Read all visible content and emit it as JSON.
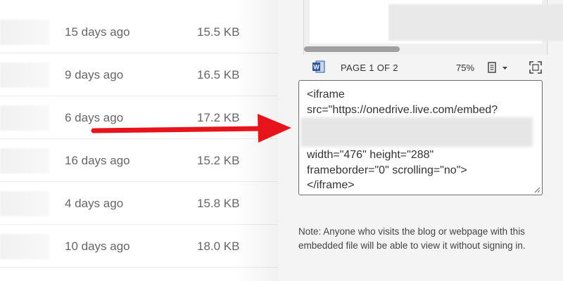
{
  "file_list": {
    "rows": [
      {
        "modified": "15 days ago",
        "size": "15.5 KB"
      },
      {
        "modified": "9 days ago",
        "size": "16.5 KB"
      },
      {
        "modified": "6 days ago",
        "size": "17.2 KB"
      },
      {
        "modified": "16 days ago",
        "size": "15.2 KB"
      },
      {
        "modified": "4 days ago",
        "size": "15.8 KB"
      },
      {
        "modified": "10 days ago",
        "size": "18.0 KB"
      }
    ]
  },
  "preview_toolbar": {
    "app_icon": "word-icon",
    "page_indicator": "PAGE 1 OF 2",
    "zoom": "75%",
    "view_icon": "document-view-icon",
    "fullscreen_icon": "fullscreen-icon"
  },
  "embed_code": {
    "line1": "<iframe",
    "line2": "src=\"https://onedrive.live.com/embed?",
    "line3": "width=\"476\" height=\"288\"",
    "line4": "frameborder=\"0\" scrolling=\"no\">",
    "line5": "</iframe>"
  },
  "note": "Note: Anyone who visits the blog or webpage with this embedded file will be able to view it without signing in.",
  "colors": {
    "arrow": "#e8141b",
    "word_blue": "#2b579a"
  }
}
